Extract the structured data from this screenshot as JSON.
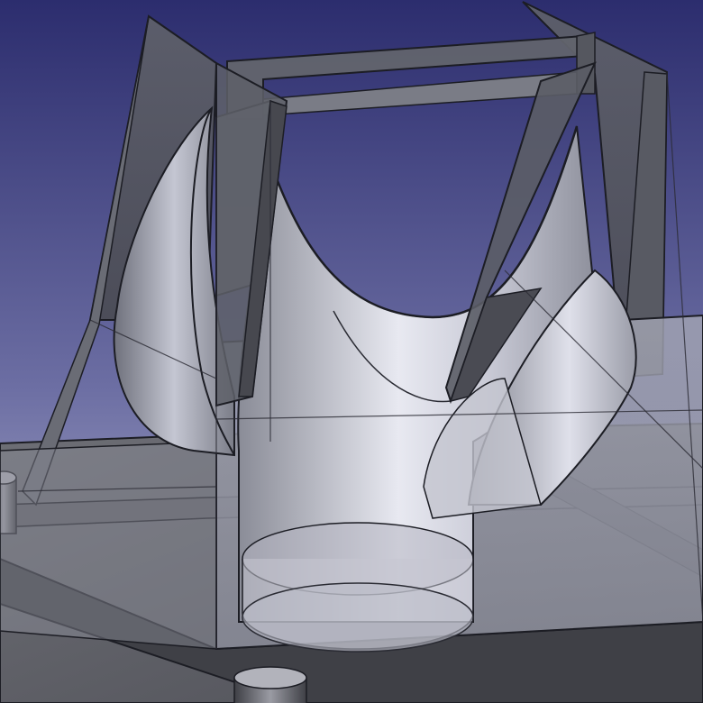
{
  "viewport": {
    "background_top": "#2c2d6e",
    "background_bottom": "#b9bbd4"
  },
  "model": {
    "body_color": "#8c8e98",
    "edge_color": "#1c1d24",
    "plate_color": "#56575c",
    "surface_highlight": "#e7e8f0"
  }
}
